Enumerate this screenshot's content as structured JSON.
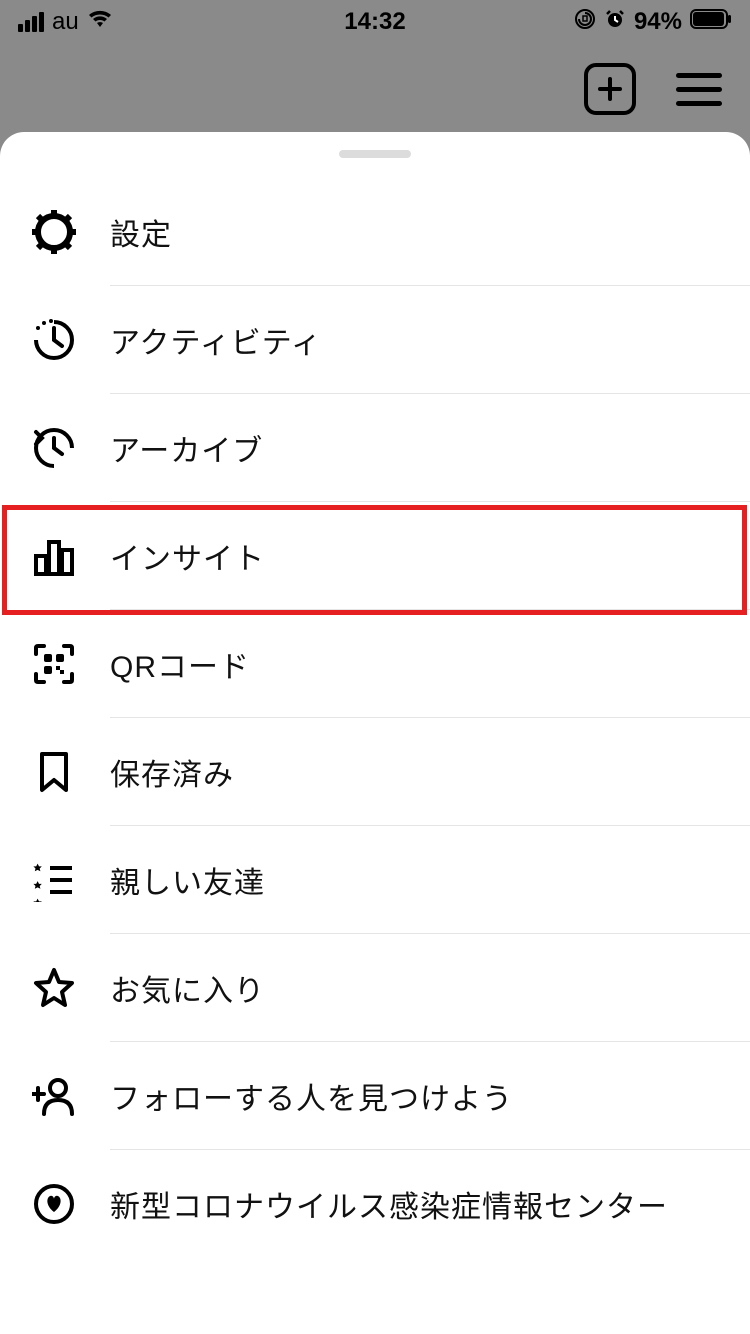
{
  "status_bar": {
    "carrier": "au",
    "time": "14:32",
    "battery": "94%"
  },
  "menu": {
    "items": [
      {
        "label": "設定"
      },
      {
        "label": "アクティビティ"
      },
      {
        "label": "アーカイブ"
      },
      {
        "label": "インサイト"
      },
      {
        "label": "QRコード"
      },
      {
        "label": "保存済み"
      },
      {
        "label": "親しい友達"
      },
      {
        "label": "お気に入り"
      },
      {
        "label": "フォローする人を見つけよう"
      },
      {
        "label": "新型コロナウイルス感染症情報センター"
      }
    ]
  }
}
